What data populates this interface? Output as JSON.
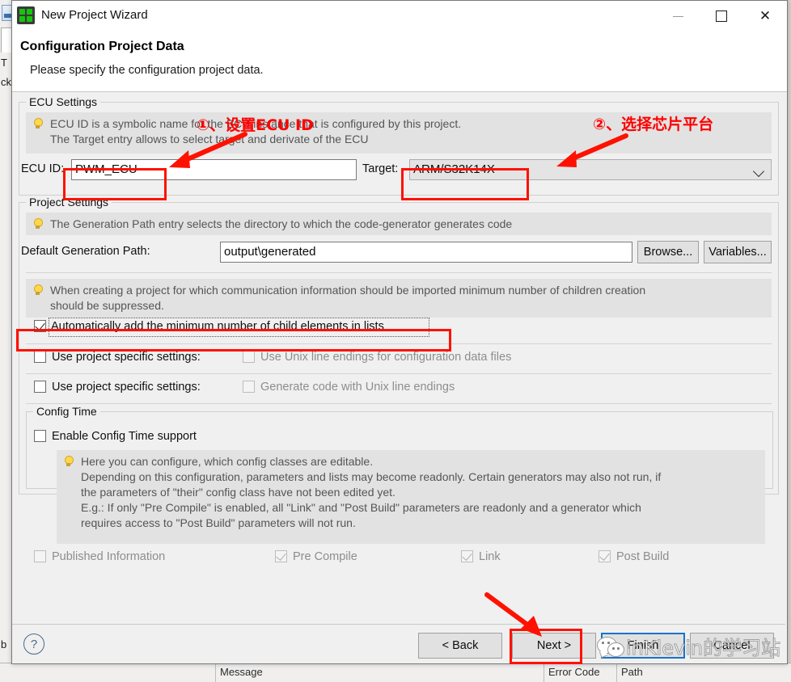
{
  "background": {
    "tab_labels": [
      "T",
      "ck"
    ],
    "left_label": "b",
    "columns": [
      "Message",
      "Error Code",
      "Path"
    ]
  },
  "window": {
    "title": "New Project Wizard",
    "icon": "eb-tresos-icon",
    "minimize": "minimize-icon",
    "maximize": "maximize-icon",
    "close": "close-icon"
  },
  "header": {
    "title": "Configuration Project Data",
    "subtitle": "Please specify the configuration project data."
  },
  "ecu_settings": {
    "legend": "ECU Settings",
    "info_line1": "ECU ID is a symbolic name for the ECU instance that is configured by this project.",
    "info_line2": "The Target entry allows to select target and derivate of the ECU",
    "ecu_id_label": "ECU ID:",
    "ecu_id_value": "PWM_ECU",
    "target_label": "Target:",
    "target_value": "ARM/S32K14X"
  },
  "project_settings": {
    "legend": "Project Settings",
    "info_gen_path": "The Generation Path entry selects the directory to which the code-generator generates code",
    "gen_path_label": "Default Generation Path:",
    "gen_path_value": "output\\generated",
    "browse_label": "Browse...",
    "variables_label": "Variables...",
    "info_children_line1": "When creating a project for which communication information should be imported minimum number of children creation",
    "info_children_line2": "should be suppressed.",
    "auto_add_label": "Automatically add the minimum number of child elements in lists",
    "auto_add_checked": true,
    "row1_project_specific": "Use project specific settings:",
    "row1_sub_label": "Use Unix line endings for configuration data files",
    "row2_project_specific": "Use project specific settings:",
    "row2_sub_label": "Generate code with Unix line endings"
  },
  "config_time": {
    "legend": "Config Time",
    "enable_label": "Enable Config Time support",
    "enable_checked": false,
    "info_line1": "Here you can configure, which config classes are editable.",
    "info_line2": "Depending on this configuration, parameters and lists may become readonly. Certain generators may also not run, if",
    "info_line3": "the parameters of \"their\" config class have not been edited yet.",
    "info_line4": "E.g.: If only \"Pre Compile\" is enabled, all \"Link\" and \"Post Build\" parameters are readonly and a generator which",
    "info_line5": "requires access to \"Post Build\" parameters will not run.",
    "classes": [
      {
        "label": "Published Information",
        "checked": false
      },
      {
        "label": "Pre Compile",
        "checked": true
      },
      {
        "label": "Link",
        "checked": true
      },
      {
        "label": "Post Build",
        "checked": true
      }
    ]
  },
  "footer": {
    "help": "?",
    "back_label": "< Back",
    "next_label": "Next >",
    "finish_label": "Finish",
    "cancel_label": "Cancel"
  },
  "annotations": {
    "note1": "①、设置ECU ID",
    "note2": "②、选择芯片平台",
    "color": "#ff0000"
  },
  "watermark": {
    "text": "inKlevin的学习站",
    "icon": "wechat-bubble-icon"
  }
}
